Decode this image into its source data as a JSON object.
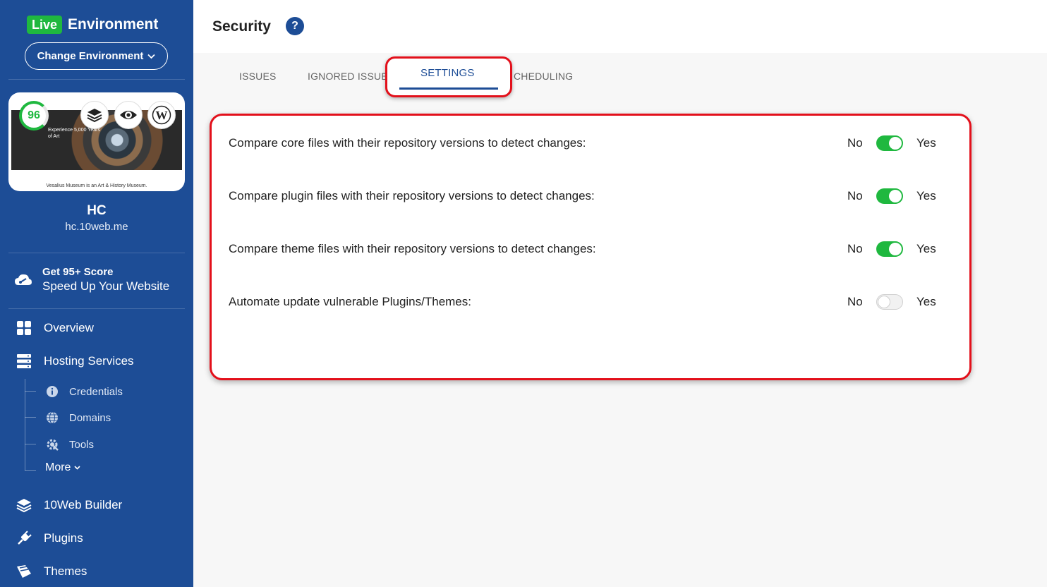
{
  "sidebar": {
    "env_badge": "Live",
    "env_title": "Environment",
    "change_env_label": "Change Environment",
    "preview": {
      "score": "96",
      "headline": "Experience 5,000 Years of Art",
      "caption": "Vesalius Museum is an Art & History Museum."
    },
    "site_name": "HC",
    "site_url": "hc.10web.me",
    "boost": {
      "line1": "Get 95+ Score",
      "line2": "Speed Up Your Website"
    },
    "nav": {
      "overview": "Overview",
      "hosting": "Hosting Services",
      "credentials": "Credentials",
      "domains": "Domains",
      "tools": "Tools",
      "more": "More",
      "builder": "10Web Builder",
      "plugins": "Plugins",
      "themes": "Themes"
    }
  },
  "header": {
    "title": "Security",
    "help": "?"
  },
  "tabs": {
    "issues": "ISSUES",
    "ignored": "IGNORED ISSUE",
    "settings": "SETTINGS",
    "scheduling": "CHEDULING"
  },
  "settings": {
    "no_label": "No",
    "yes_label": "Yes",
    "rows": [
      {
        "label": "Compare core files with their repository versions to detect changes:",
        "enabled": true
      },
      {
        "label": "Compare plugin files with their repository versions to detect changes:",
        "enabled": true
      },
      {
        "label": "Compare theme files with their repository versions to detect changes:",
        "enabled": true
      },
      {
        "label": "Automate update vulnerable Plugins/Themes:",
        "enabled": false
      }
    ]
  },
  "colors": {
    "sidebar": "#1d4d96",
    "accent_green": "#1fb83f",
    "highlight_red": "#e3101b"
  }
}
